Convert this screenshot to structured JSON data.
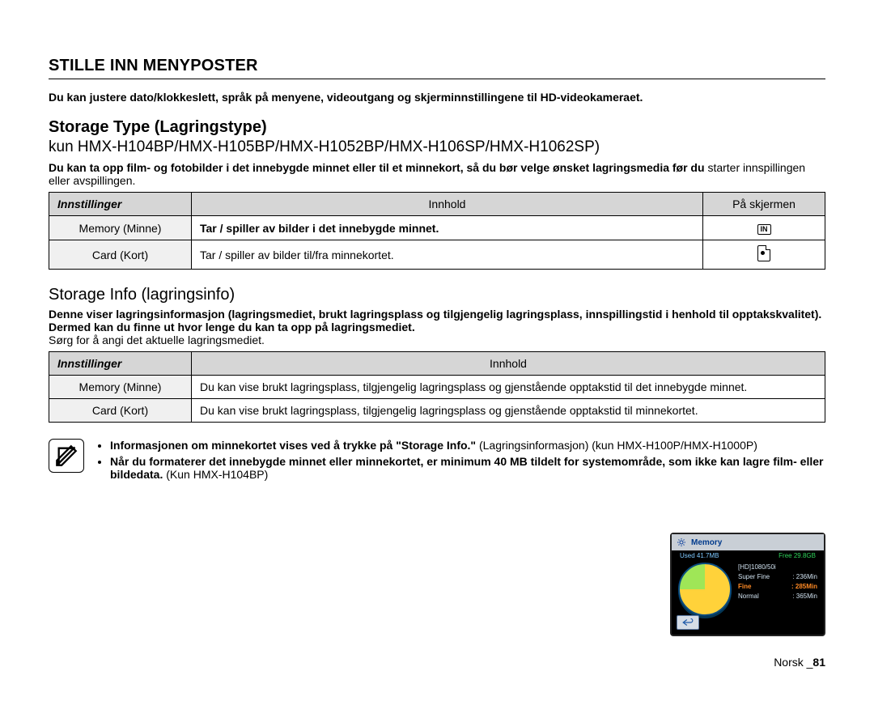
{
  "heading": "STILLE INN MENYPOSTER",
  "intro": "Du kan justere dato/klokkeslett, språk på menyene, videoutgang og skjerminnstillingene til HD-videokameraet.",
  "section1": {
    "title": "Storage Type (Lagringstype)",
    "sub": "kun HMX-H104BP/HMX-H105BP/HMX-H1052BP/HMX-H106SP/HMX-H1062SP)",
    "p_bold": "Du kan ta opp film- og fotobilder i det innebygde minnet eller til et minnekort, så du bør velge ønsket lagringsmedia før du",
    "p_plain": "starter innspillingen eller avspillingen.",
    "headers": {
      "c1": "Innstillinger",
      "c2": "Innhold",
      "c3": "På skjermen"
    },
    "rows": [
      {
        "c1": "Memory (Minne)",
        "c2": "Tar / spiller av bilder i det innebygde minnet.",
        "bold": true,
        "icon": "in"
      },
      {
        "c1": "Card (Kort)",
        "c2": "Tar / spiller av bilder til/fra minnekortet.",
        "bold": false,
        "icon": "card"
      }
    ]
  },
  "section2": {
    "title": "Storage Info (lagringsinfo)",
    "p_bold": "Denne viser lagringsinformasjon (lagringsmediet, brukt lagringsplass og tilgjengelig lagringsplass, innspillingstid i henhold til opptakskvalitet). Dermed kan du finne ut hvor lenge du kan ta opp på lagringsmediet.",
    "p_plain": "Sørg for å angi det aktuelle lagringsmediet.",
    "headers": {
      "c1": "Innstillinger",
      "c2": "Innhold"
    },
    "rows": [
      {
        "c1": "Memory (Minne)",
        "c2_bold": "Du kan vise brukt lagringsplass, tilgjengelig lagringsplass og gjenstående opptakstid til det innebygde minnet.",
        "c2_plain": ""
      },
      {
        "c1": "Card (Kort)",
        "c2_bold": "Du kan vise brukt lagringsplass, tilgjengelig lagringsplass og gjenstående opptakstid til",
        "c2_plain": " minnekortet."
      }
    ]
  },
  "note": {
    "b1_bold": "Informasjonen om minnekortet vises ved å trykke på \"Storage Info.\"",
    "b1_plain": " (Lagringsinformasjon) (kun HMX-H100P/HMX-H1000P)",
    "b2_bold": "Når du formaterer det innebygde minnet eller minnekortet, er minimum 40 MB tildelt for systemområde, som ikke kan lagre film- eller bildedata.",
    "b2_plain": " (Kun HMX-H104BP)"
  },
  "screen": {
    "title": "Memory",
    "used_label": "Used",
    "used_val": "41.7MB",
    "free_label": "Free",
    "free_val": "29.8GB",
    "mode": "[HD]1080/50i",
    "r1": {
      "l": "Super Fine",
      "v": "236Min"
    },
    "r2": {
      "l": "Fine",
      "v": "285Min"
    },
    "r3": {
      "l": "Normal",
      "v": "365Min"
    }
  },
  "footer_label": "Norsk _",
  "page_number": "81"
}
